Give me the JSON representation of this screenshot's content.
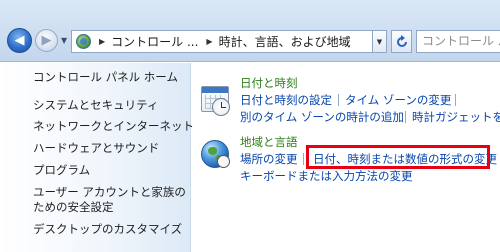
{
  "nav": {
    "back_label": "◀",
    "forward_label": "▶",
    "history_label": "▼"
  },
  "address": {
    "breadcrumb": [
      "コントロール ...",
      "時計、言語、および地域"
    ],
    "separator": "▶",
    "dropdown_label": "▼",
    "refresh_label": "↺"
  },
  "search": {
    "placeholder": "コントロール パネ"
  },
  "sidebar": {
    "items": [
      {
        "label": "コントロール パネル ホーム"
      },
      {
        "label": "システムとセキュリティ"
      },
      {
        "label": "ネットワークとインターネット"
      },
      {
        "label": "ハードウェアとサウンド"
      },
      {
        "label": "プログラム"
      },
      {
        "label": "ユーザー アカウントと家族の"
      },
      {
        "label": "ための安全設定"
      },
      {
        "label": "デスクトップのカスタマイズ"
      }
    ]
  },
  "sections": {
    "datetime": {
      "title": "日付と時刻",
      "icon": "clock-calendar-icon",
      "links": [
        "日付と時刻の設定",
        "タイム ゾーンの変更",
        "別のタイム ゾーンの時計の追加",
        "時計ガジェットを"
      ]
    },
    "region": {
      "title": "地域と言語",
      "icon": "globe-icon",
      "links": [
        "場所の変更",
        "日付、時刻または数値の形式の変更",
        "キーボードまたは入力方法の変更"
      ]
    }
  },
  "colors": {
    "link": "#0645ad",
    "section_title": "#2e7d1b",
    "highlight": "#e60012",
    "toolbar": "#cfdff1"
  }
}
